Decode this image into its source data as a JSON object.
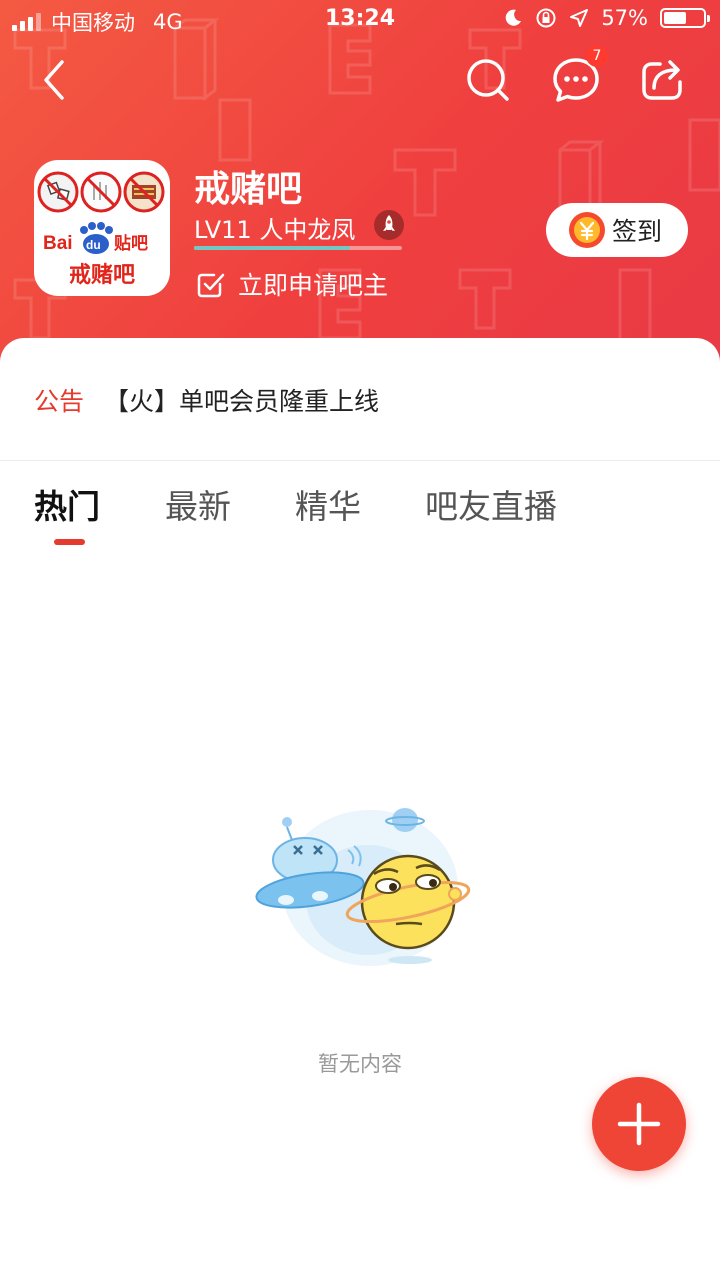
{
  "status_bar": {
    "carrier": "中国移动",
    "network": "4G",
    "time": "13:24",
    "battery_percent": "57%",
    "battery_level": 0.57,
    "signal_bars": 3
  },
  "nav": {
    "back_icon": "chevron-left-icon",
    "search_icon": "search-icon",
    "messages_icon": "chat-bubble-icon",
    "messages_badge": "7",
    "share_icon": "share-icon"
  },
  "forum": {
    "name": "戒赌吧",
    "level": "LV11 人中龙凤",
    "level_progress": 0.75,
    "apply_label": "立即申请吧主",
    "checkin_label": "签到",
    "avatar_brand": "Bai",
    "avatar_brand2": "du",
    "avatar_brand3": "贴吧",
    "avatar_name": "戒赌吧"
  },
  "notice": {
    "tag": "公告",
    "text": "【火】单吧会员隆重上线"
  },
  "tabs": [
    {
      "label": "热门",
      "active": true
    },
    {
      "label": "最新",
      "active": false
    },
    {
      "label": "精华",
      "active": false
    },
    {
      "label": "吧友直播",
      "active": false
    }
  ],
  "empty_state": {
    "text": "暂无内容"
  },
  "fab": {
    "icon": "plus-icon"
  },
  "colors": {
    "brand_red": "#ef4536",
    "accent_teal": "#74c8c4"
  }
}
